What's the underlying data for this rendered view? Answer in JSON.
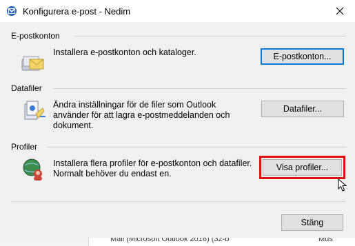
{
  "window": {
    "title": "Konfigurera e-post - Nedim",
    "icon": "mail-setup-icon",
    "close_glyph": "✕"
  },
  "sections": {
    "email": {
      "label": "E-postkonton",
      "description": "Installera e-postkonton och kataloger.",
      "button": "E-postkonton...",
      "icon": "email-envelope-icon"
    },
    "datafiles": {
      "label": "Datafiler",
      "description": "Ändra inställningar för de filer som Outlook använder för att lagra e-postmeddelanden och dokument.",
      "button": "Datafiler...",
      "icon": "data-files-icon"
    },
    "profiles": {
      "label": "Profiler",
      "description": "Installera flera profiler för e-postkonton och datafiler. Normalt behöver du endast en.",
      "button": "Visa profiler...",
      "icon": "profiles-globe-icon"
    }
  },
  "footer": {
    "close_button": "Stäng"
  },
  "background_strip": {
    "text": "Mail (Microsoft Outlook 2016) (32-b",
    "text2": "Mus"
  },
  "colors": {
    "highlight": "#e01010",
    "default_button_border": "#0078d7"
  }
}
